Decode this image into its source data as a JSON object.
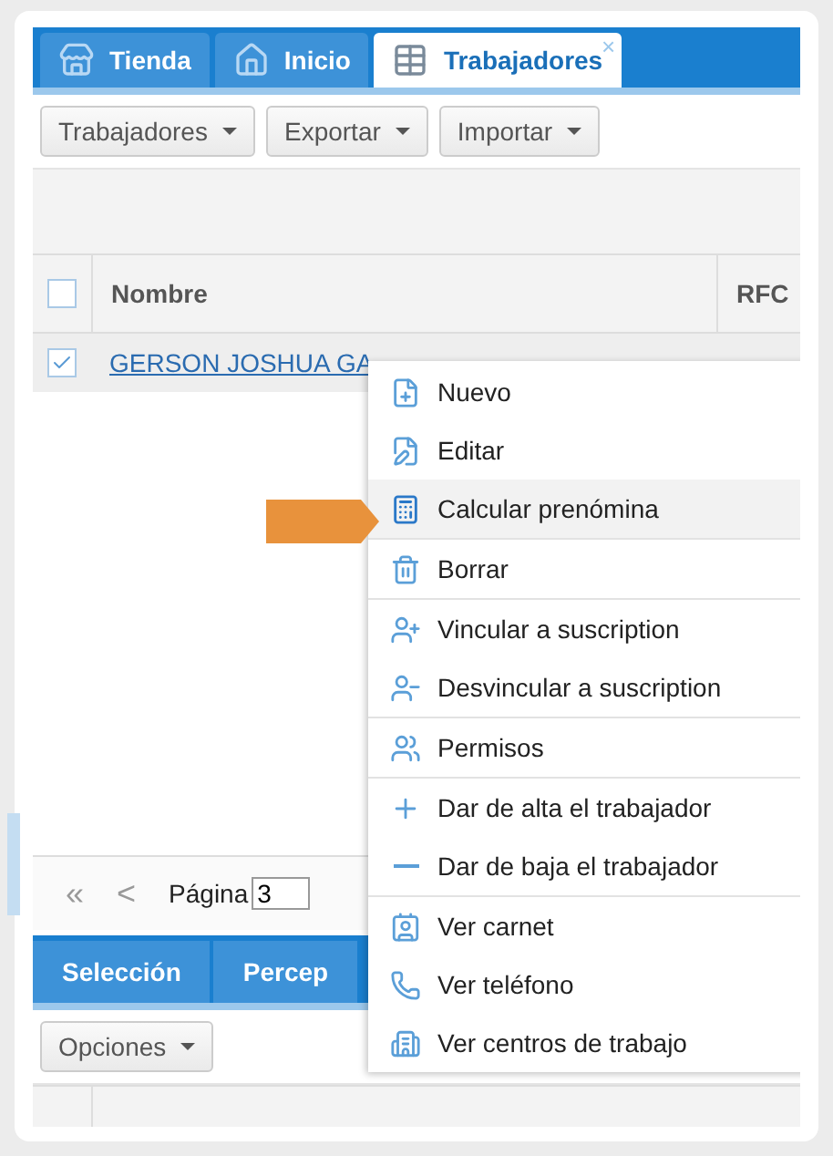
{
  "tabs": [
    {
      "label": "Tienda",
      "kind": "store",
      "selected": false
    },
    {
      "label": "Inicio",
      "kind": "home",
      "selected": false
    },
    {
      "label": "Trabajadores",
      "kind": "table",
      "selected": true,
      "close": "×"
    }
  ],
  "toolbar": [
    "Trabajadores",
    "Exportar",
    "Importar"
  ],
  "grid": {
    "columns": [
      "Nombre",
      "RFC"
    ],
    "header_checked": false,
    "rows": [
      {
        "name": "GERSON JOSHUA GA",
        "checked": true
      }
    ]
  },
  "pager": {
    "first": "«",
    "prev": "<",
    "label": "Página",
    "page": "3"
  },
  "bottom_tabs": [
    {
      "label": "Selección",
      "selected": false
    },
    {
      "label": "Percep",
      "selected": false
    }
  ],
  "bottom_toolbar": [
    "Opciones"
  ],
  "context_menu": [
    [
      {
        "label": "Nuevo",
        "kind": "new",
        "selected": false
      },
      {
        "label": "Editar",
        "kind": "edit",
        "selected": false
      },
      {
        "label": "Calcular prenómina",
        "kind": "calc",
        "selected": true
      }
    ],
    [
      {
        "label": "Borrar",
        "kind": "trash",
        "selected": false
      }
    ],
    [
      {
        "label": "Vincular a suscription",
        "kind": "user-plus",
        "selected": false
      },
      {
        "label": "Desvincular a suscription",
        "kind": "user-minus",
        "selected": false
      }
    ],
    [
      {
        "label": "Permisos",
        "kind": "users",
        "selected": false
      }
    ],
    [
      {
        "label": "Dar de alta el trabajador",
        "kind": "plus",
        "selected": false
      },
      {
        "label": "Dar de baja el trabajador",
        "kind": "minus",
        "selected": false
      }
    ],
    [
      {
        "label": "Ver carnet",
        "kind": "card",
        "selected": false
      },
      {
        "label": "Ver teléfono",
        "kind": "phone",
        "selected": false
      },
      {
        "label": "Ver centros de trabajo",
        "kind": "building",
        "selected": false
      }
    ]
  ]
}
